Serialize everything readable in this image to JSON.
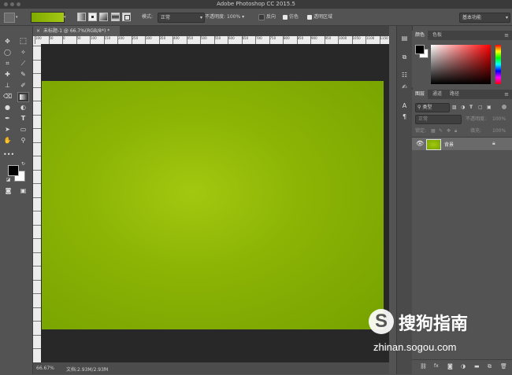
{
  "window": {
    "title": "Adobe Photoshop CC 2015.5"
  },
  "options_bar": {
    "mode_label": "模式:",
    "mode_value": "正常",
    "opacity_label": "不透明度:",
    "opacity_value": "100%",
    "reverse_label": "反向",
    "dither_label": "仿色",
    "transparency_label": "透明区域",
    "workspace_value": "基本功能",
    "gradient_colors": [
      "#7faa00",
      "#a5c815"
    ]
  },
  "document": {
    "tab_title": "未标题-1 @ 66.7%(RGB/8*) *",
    "zoom": "66.67%",
    "doc_info": "文档:2.93M/2.93M",
    "ruler_labels": [
      "100",
      "50",
      "0",
      "50",
      "100",
      "150",
      "200",
      "250",
      "300",
      "350",
      "400",
      "450",
      "500",
      "550",
      "600",
      "650",
      "700",
      "750",
      "800",
      "850",
      "900",
      "950",
      "1000",
      "1050",
      "1100",
      "1150"
    ],
    "canvas_colors": {
      "center": "#a3c810",
      "edge": "#76a200"
    }
  },
  "color_panel": {
    "tabs": [
      "颜色",
      "色板"
    ]
  },
  "layers_panel": {
    "tabs": [
      "图层",
      "通道",
      "路径"
    ],
    "kind_label": "类型",
    "blend_mode": "正常",
    "opacity_label": "不透明度:",
    "opacity_value": "100%",
    "lock_label": "锁定:",
    "fill_label": "填充:",
    "fill_value": "100%",
    "layers": [
      {
        "name": "背景",
        "visible": true,
        "locked": true
      }
    ]
  },
  "watermark": {
    "brand": "搜狗指南",
    "url": "zhinan.sogou.com"
  }
}
